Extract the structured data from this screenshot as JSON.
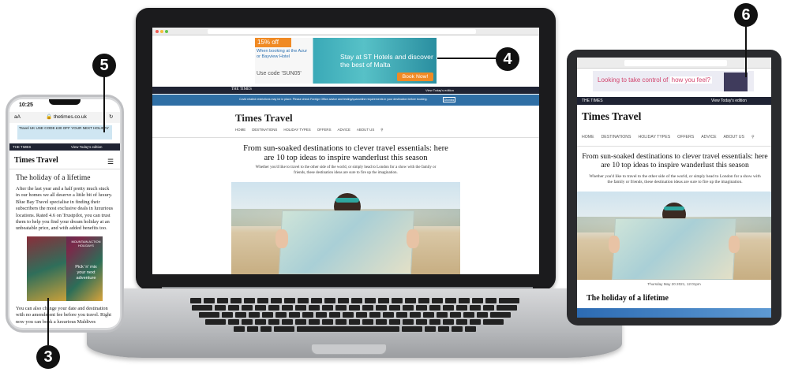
{
  "callouts": {
    "phone_bottom": "3",
    "laptop_ad": "4",
    "phone_ad": "5",
    "tablet_ad": "6"
  },
  "laptop": {
    "ad": {
      "badge": "15% off",
      "small": "When booking at the Azur or Bayview Hotel",
      "code": "Use code 'SUN05'",
      "headline": "Stay at ST Hotels and discover the best of Malta",
      "cta": "Book Now!"
    },
    "topbar_right": "View Today's edition",
    "banner_text": "Covid related restrictions may be in place. Please check Foreign Office advice and testing/quarantine requirements in your destination before booking.",
    "banner_button": "Dismiss",
    "masthead": "Times Travel",
    "nav": [
      "HOME",
      "DESTINATIONS",
      "HOLIDAY TYPES",
      "OFFERS",
      "ADVICE",
      "ABOUT US"
    ],
    "headline": "From sun-soaked destinations to clever travel essentials: here are 10 top ideas to inspire wanderlust this season",
    "standfirst": "Whether you'd like to travel to the other side of the world, or simply head to London for a show with the family or friends, these destination ideas are sure to fire up the imagination."
  },
  "phone": {
    "time": "10:25",
    "url": "thetimes.co.uk",
    "ad_text": "Travel UK   USE CODE   £30 OFF YOUR NEXT HOLIDAY",
    "topbar_logo": "THE TIMES",
    "topbar_right": "View Today's edition",
    "masthead": "Times Travel",
    "subheading": "The holiday of a lifetime",
    "body": "After the last year and a half pretty much stuck in our homes we all deserve a little bit of luxury. Blue Bay Travel specialise in finding their subscribers the most exclusive deals in luxurious locations. Rated 4.6 on Trustpilot, you can trust them to help you find your dream holiday at an unbeatable price, and with added benefits too.",
    "ad_label": "MOUNTAIN ACTION HOLIDAYS",
    "ad_pick": "Pick 'n' mix your next adventure",
    "body2": "You can also change your date and destination with no amendment fee before you travel. Right now you can book a luxurious Maldives"
  },
  "tablet": {
    "ad_text_a": "Looking to take control of",
    "ad_text_b": "how you feel?",
    "topbar_logo": "THE TIMES",
    "topbar_right": "View Today's edition",
    "masthead": "Times Travel",
    "nav": [
      "HOME",
      "DESTINATIONS",
      "HOLIDAY TYPES",
      "OFFERS",
      "ADVICE",
      "ABOUT US"
    ],
    "headline": "From sun-soaked destinations to clever travel essentials: here are 10 top ideas to inspire wanderlust this season",
    "standfirst": "Whether you'd like to travel to the other side of the world, or simply head to London for a show with the family or friends, these destination ideas are sure to fire up the imagination.",
    "date": "Thursday May 20 2021, 12:01pm",
    "subheading": "The holiday of a lifetime"
  },
  "colors": {
    "accent_orange": "#f08a24",
    "nav_dark": "#1f2333",
    "banner_blue": "#2f6fa5",
    "tablet_ad_pink": "#d2456e"
  },
  "icons": [
    "search-icon",
    "menu-icon",
    "lock-icon",
    "reload-icon"
  ]
}
